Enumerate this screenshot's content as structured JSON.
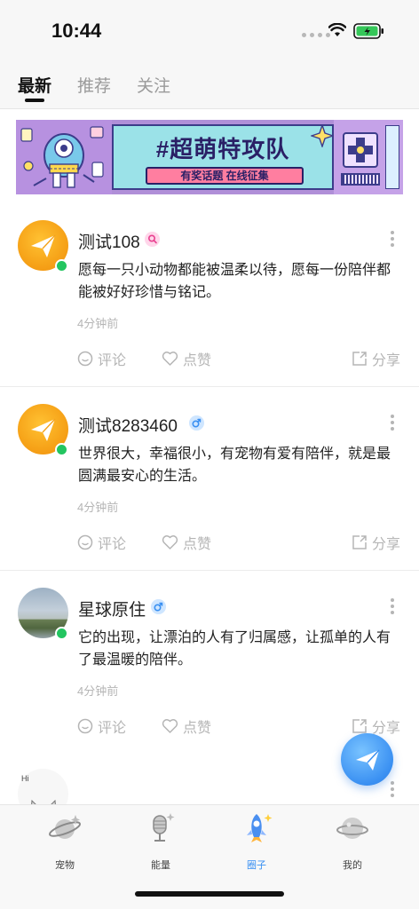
{
  "status_bar": {
    "time": "10:44"
  },
  "tabs": [
    {
      "label": "最新",
      "active": true
    },
    {
      "label": "推荐",
      "active": false
    },
    {
      "label": "关注",
      "active": false
    }
  ],
  "banner": {
    "title": "#超萌特攻队",
    "subtitle": "有奖话题 在线征集"
  },
  "posts": [
    {
      "username": "测试108",
      "gender": "female",
      "content": "愿每一只小动物都能被温柔以待，愿每一份陪伴都能被好好珍惜与铭记。",
      "time": "4分钟前"
    },
    {
      "username": "测试8283460",
      "gender": "male",
      "content": "世界很大，幸福很小，有宠物有爱有陪伴，就是最圆满最安心的生活。",
      "time": "4分钟前"
    },
    {
      "username": "星球原住",
      "gender": "male",
      "content": "它的出现，让漂泊的人有了归属感，让孤单的人有了最温暖的陪伴。",
      "time": "4分钟前"
    }
  ],
  "post_actions": {
    "comment": "评论",
    "like": "点赞",
    "share": "分享"
  },
  "partial_post": {
    "avatar_text": "Hi"
  },
  "bottom_nav": [
    {
      "label": "宠物",
      "icon": "planet-icon",
      "active": false
    },
    {
      "label": "能量",
      "icon": "microphone-icon",
      "active": false
    },
    {
      "label": "圈子",
      "icon": "rocket-icon",
      "active": true
    },
    {
      "label": "我的",
      "icon": "planet-profile-icon",
      "active": false
    }
  ],
  "colors": {
    "accent": "#3a90f2",
    "online": "#23c560",
    "avatar_orange": "#f7a51a"
  }
}
